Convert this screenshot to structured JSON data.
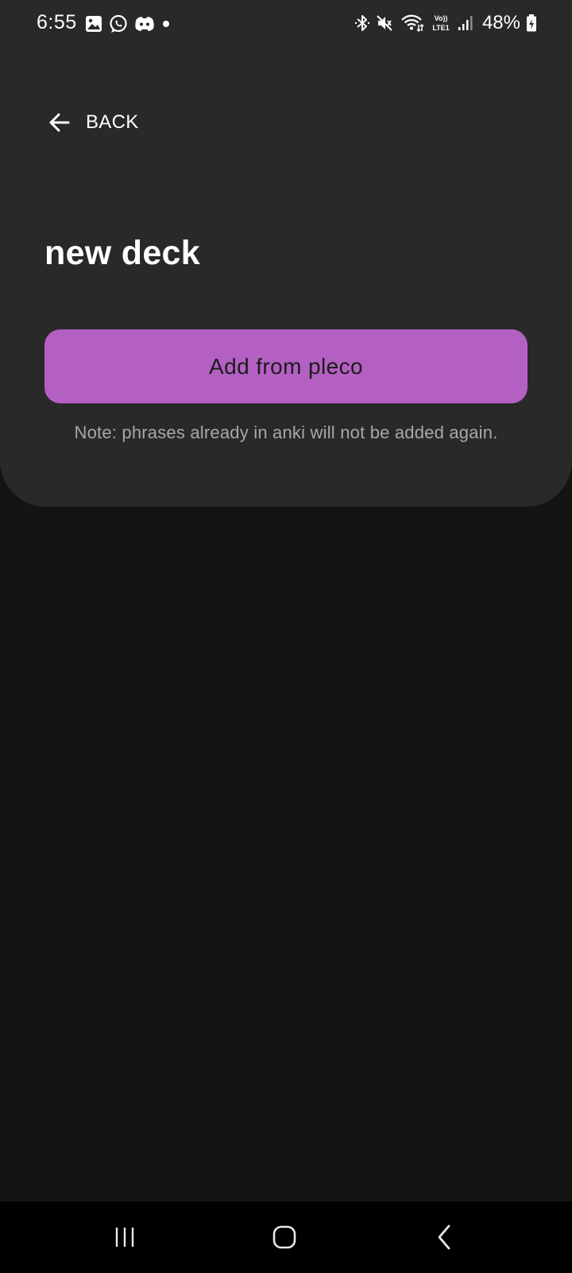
{
  "status_bar": {
    "time": "6:55",
    "battery_percent": "48%",
    "left_icons": [
      "gallery-icon",
      "whatsapp-icon",
      "discord-icon",
      "notification-dot-icon"
    ],
    "right_icons": [
      "bluetooth-icon",
      "mute-icon",
      "wifi-icon",
      "volte-lte-icon",
      "signal-icon",
      "battery-charging-icon"
    ],
    "volte_top": "Vo))",
    "volte_bottom": "LTE1"
  },
  "header": {
    "back_label": "BACK",
    "back_icon": "arrow-left-icon"
  },
  "main": {
    "title": "new deck",
    "primary_button_label": "Add from pleco",
    "note": "Note: phrases already in anki will not be added again."
  },
  "nav_bar": {
    "recents_icon": "recents-icon",
    "home_icon": "home-icon",
    "back_icon": "nav-back-icon"
  },
  "colors": {
    "background": "#141414",
    "card": "#292929",
    "accent": "#b460c3",
    "note_text": "#a8a8a8",
    "nav_bar": "#000000"
  }
}
